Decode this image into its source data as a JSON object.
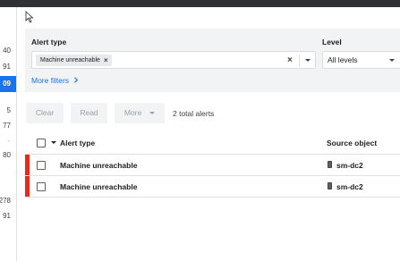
{
  "left_sidebar": {
    "numbers": [
      {
        "text": "40",
        "selected": false
      },
      {
        "text": "91",
        "selected": false
      },
      {
        "text": "09",
        "selected": true
      },
      {
        "text": "5",
        "selected": false
      },
      {
        "text": "77",
        "selected": false
      },
      {
        "text": "-",
        "selected": false
      },
      {
        "text": "80",
        "selected": false
      },
      {
        "text": "278",
        "selected": false
      },
      {
        "text": "91",
        "selected": false
      }
    ]
  },
  "filters": {
    "alert_type_label": "Alert type",
    "alert_type_chips": [
      "Machine unreachable"
    ],
    "level_label": "Level",
    "level_value": "All levels",
    "more_filters": "More filters"
  },
  "toolbar": {
    "clear_label": "Clear",
    "read_label": "Read",
    "more_label": "More",
    "total_alerts": "2 total alerts"
  },
  "table": {
    "columns": [
      "Alert type",
      "Source object"
    ],
    "rows": [
      {
        "alert_type": "Machine unreachable",
        "source_object": "sm-dc2",
        "severity_color": "#d93025"
      },
      {
        "alert_type": "Machine unreachable",
        "source_object": "sm-dc2",
        "severity_color": "#d93025"
      }
    ]
  },
  "colors": {
    "accent": "#1a73e8",
    "severity_error": "#d93025",
    "panel_bg": "#f1f3f4"
  }
}
